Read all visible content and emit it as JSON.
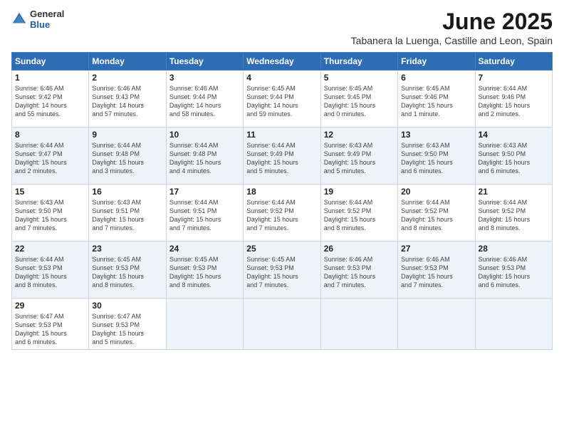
{
  "header": {
    "logo_general": "General",
    "logo_blue": "Blue",
    "title": "June 2025",
    "location": "Tabanera la Luenga, Castille and Leon, Spain"
  },
  "weekdays": [
    "Sunday",
    "Monday",
    "Tuesday",
    "Wednesday",
    "Thursday",
    "Friday",
    "Saturday"
  ],
  "weeks": [
    [
      {
        "day": "1",
        "info": "Sunrise: 6:46 AM\nSunset: 9:42 PM\nDaylight: 14 hours\nand 55 minutes."
      },
      {
        "day": "2",
        "info": "Sunrise: 6:46 AM\nSunset: 9:43 PM\nDaylight: 14 hours\nand 57 minutes."
      },
      {
        "day": "3",
        "info": "Sunrise: 6:46 AM\nSunset: 9:44 PM\nDaylight: 14 hours\nand 58 minutes."
      },
      {
        "day": "4",
        "info": "Sunrise: 6:45 AM\nSunset: 9:44 PM\nDaylight: 14 hours\nand 59 minutes."
      },
      {
        "day": "5",
        "info": "Sunrise: 6:45 AM\nSunset: 9:45 PM\nDaylight: 15 hours\nand 0 minutes."
      },
      {
        "day": "6",
        "info": "Sunrise: 6:45 AM\nSunset: 9:46 PM\nDaylight: 15 hours\nand 1 minute."
      },
      {
        "day": "7",
        "info": "Sunrise: 6:44 AM\nSunset: 9:46 PM\nDaylight: 15 hours\nand 2 minutes."
      }
    ],
    [
      {
        "day": "8",
        "info": "Sunrise: 6:44 AM\nSunset: 9:47 PM\nDaylight: 15 hours\nand 2 minutes."
      },
      {
        "day": "9",
        "info": "Sunrise: 6:44 AM\nSunset: 9:48 PM\nDaylight: 15 hours\nand 3 minutes."
      },
      {
        "day": "10",
        "info": "Sunrise: 6:44 AM\nSunset: 9:48 PM\nDaylight: 15 hours\nand 4 minutes."
      },
      {
        "day": "11",
        "info": "Sunrise: 6:44 AM\nSunset: 9:49 PM\nDaylight: 15 hours\nand 5 minutes."
      },
      {
        "day": "12",
        "info": "Sunrise: 6:43 AM\nSunset: 9:49 PM\nDaylight: 15 hours\nand 5 minutes."
      },
      {
        "day": "13",
        "info": "Sunrise: 6:43 AM\nSunset: 9:50 PM\nDaylight: 15 hours\nand 6 minutes."
      },
      {
        "day": "14",
        "info": "Sunrise: 6:43 AM\nSunset: 9:50 PM\nDaylight: 15 hours\nand 6 minutes."
      }
    ],
    [
      {
        "day": "15",
        "info": "Sunrise: 6:43 AM\nSunset: 9:50 PM\nDaylight: 15 hours\nand 7 minutes."
      },
      {
        "day": "16",
        "info": "Sunrise: 6:43 AM\nSunset: 9:51 PM\nDaylight: 15 hours\nand 7 minutes."
      },
      {
        "day": "17",
        "info": "Sunrise: 6:44 AM\nSunset: 9:51 PM\nDaylight: 15 hours\nand 7 minutes."
      },
      {
        "day": "18",
        "info": "Sunrise: 6:44 AM\nSunset: 9:52 PM\nDaylight: 15 hours\nand 7 minutes."
      },
      {
        "day": "19",
        "info": "Sunrise: 6:44 AM\nSunset: 9:52 PM\nDaylight: 15 hours\nand 8 minutes."
      },
      {
        "day": "20",
        "info": "Sunrise: 6:44 AM\nSunset: 9:52 PM\nDaylight: 15 hours\nand 8 minutes."
      },
      {
        "day": "21",
        "info": "Sunrise: 6:44 AM\nSunset: 9:52 PM\nDaylight: 15 hours\nand 8 minutes."
      }
    ],
    [
      {
        "day": "22",
        "info": "Sunrise: 6:44 AM\nSunset: 9:53 PM\nDaylight: 15 hours\nand 8 minutes."
      },
      {
        "day": "23",
        "info": "Sunrise: 6:45 AM\nSunset: 9:53 PM\nDaylight: 15 hours\nand 8 minutes."
      },
      {
        "day": "24",
        "info": "Sunrise: 6:45 AM\nSunset: 9:53 PM\nDaylight: 15 hours\nand 8 minutes."
      },
      {
        "day": "25",
        "info": "Sunrise: 6:45 AM\nSunset: 9:53 PM\nDaylight: 15 hours\nand 7 minutes."
      },
      {
        "day": "26",
        "info": "Sunrise: 6:46 AM\nSunset: 9:53 PM\nDaylight: 15 hours\nand 7 minutes."
      },
      {
        "day": "27",
        "info": "Sunrise: 6:46 AM\nSunset: 9:53 PM\nDaylight: 15 hours\nand 7 minutes."
      },
      {
        "day": "28",
        "info": "Sunrise: 6:46 AM\nSunset: 9:53 PM\nDaylight: 15 hours\nand 6 minutes."
      }
    ],
    [
      {
        "day": "29",
        "info": "Sunrise: 6:47 AM\nSunset: 9:53 PM\nDaylight: 15 hours\nand 6 minutes."
      },
      {
        "day": "30",
        "info": "Sunrise: 6:47 AM\nSunset: 9:53 PM\nDaylight: 15 hours\nand 5 minutes."
      },
      {
        "day": "",
        "info": ""
      },
      {
        "day": "",
        "info": ""
      },
      {
        "day": "",
        "info": ""
      },
      {
        "day": "",
        "info": ""
      },
      {
        "day": "",
        "info": ""
      }
    ]
  ]
}
